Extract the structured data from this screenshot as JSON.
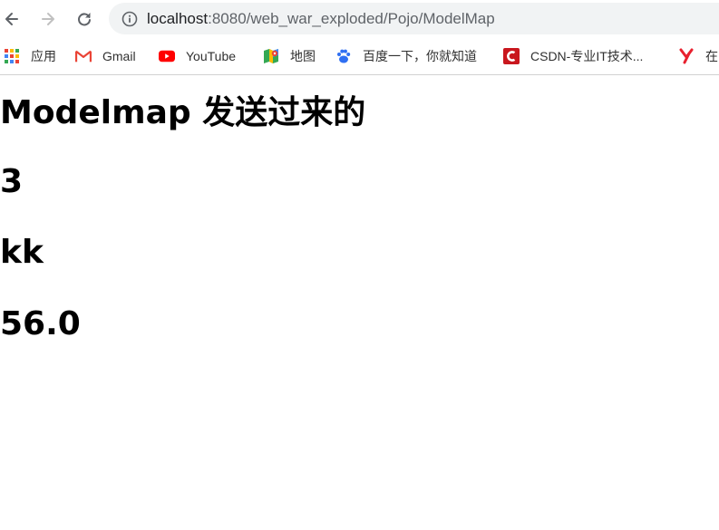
{
  "browser": {
    "url_host": "localhost",
    "url_path": ":8080/web_war_exploded/Pojo/ModelMap",
    "icons": {
      "back": "back-arrow-icon",
      "forward": "forward-arrow-icon",
      "reload": "reload-icon",
      "site_info": "info-icon"
    }
  },
  "bookmarks": [
    {
      "label": "应用",
      "icon": "apps-grid-icon"
    },
    {
      "label": "Gmail",
      "icon": "gmail-icon"
    },
    {
      "label": "YouTube",
      "icon": "youtube-icon"
    },
    {
      "label": "地图",
      "icon": "maps-icon"
    },
    {
      "label": "百度一下，你就知道",
      "icon": "baidu-icon"
    },
    {
      "label": "CSDN-专业IT技术...",
      "icon": "csdn-icon"
    },
    {
      "label": "在",
      "icon": "y-icon"
    }
  ],
  "page": {
    "heading": "Modelmap 发送过来的",
    "values": [
      "3",
      "kk",
      "56.0"
    ]
  }
}
